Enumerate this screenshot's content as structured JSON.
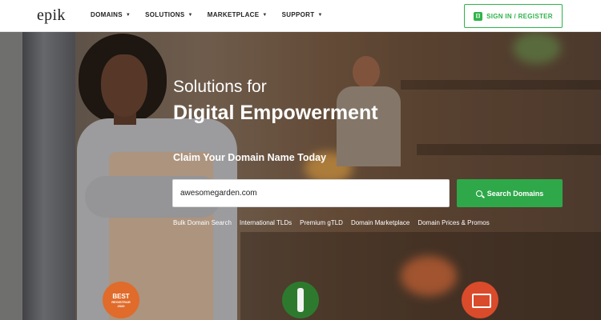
{
  "header": {
    "logo": "epik",
    "nav": [
      {
        "label": "DOMAINS"
      },
      {
        "label": "SOLUTIONS"
      },
      {
        "label": "MARKETPLACE"
      },
      {
        "label": "SUPPORT"
      }
    ],
    "signin_label": "SIGN IN / REGISTER"
  },
  "hero": {
    "subtitle": "Solutions for",
    "title": "Digital Empowerment",
    "claim": "Claim Your Domain Name Today",
    "search_value": "awesomegarden.com",
    "search_button": "Search Domains",
    "links": [
      {
        "label": "Bulk Domain Search"
      },
      {
        "label": "International TLDs"
      },
      {
        "label": "Premium gTLD"
      },
      {
        "label": "Domain Marketplace"
      },
      {
        "label": "Domain Prices & Promos"
      }
    ],
    "badge1": {
      "line1": "BEST",
      "line2": "REGISTRAR",
      "line3": "2020"
    }
  },
  "colors": {
    "accent_green": "#2fa84a",
    "header_bg": "#ffffff",
    "badge_orange": "#e06b2a"
  },
  "icons": [
    "signin-icon",
    "search-icon",
    "caret-down-icon",
    "award-badge-icon"
  ]
}
